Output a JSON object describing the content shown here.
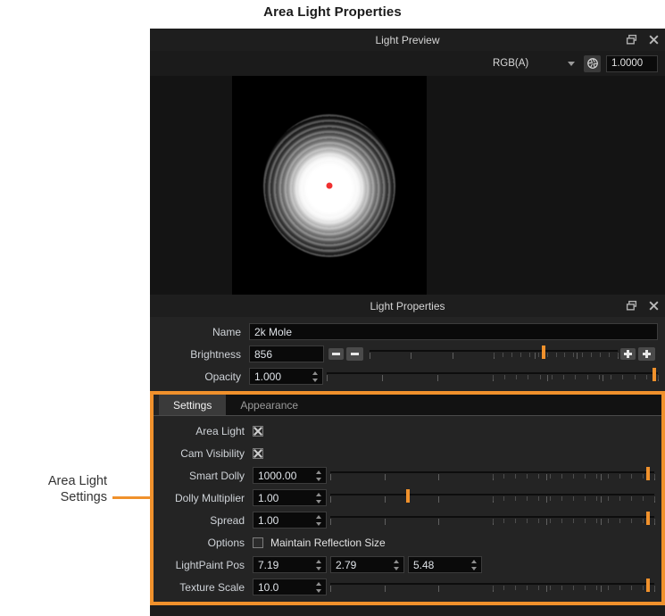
{
  "figure": {
    "title": "Area Light Properties",
    "annotation": "Area Light\nSettings",
    "annotation_line1": "Area Light",
    "annotation_line2": "Settings",
    "accent_color": "#f0912c"
  },
  "preview_panel": {
    "title": "Light Preview",
    "restore_icon": "restore-icon",
    "close_icon": "close-icon",
    "channel_select": {
      "value": "RGB(A)",
      "caret_icon": "chevron-down-icon"
    },
    "aperture_icon": "aperture-icon",
    "exposure_value": "1.0000",
    "viewport": {
      "center_dot_color": "#f03030",
      "background_color": "#000000"
    }
  },
  "properties_panel": {
    "title": "Light Properties",
    "restore_icon": "restore-icon",
    "close_icon": "close-icon",
    "rows": {
      "name": {
        "label": "Name",
        "value": "2k Mole"
      },
      "brightness": {
        "label": "Brightness",
        "value": "856",
        "slider_percent": 70
      },
      "opacity": {
        "label": "Opacity",
        "value": "1.000",
        "slider_percent": 99
      }
    }
  },
  "settings_panel": {
    "tabs": [
      {
        "label": "Settings",
        "active": true
      },
      {
        "label": "Appearance",
        "active": false
      }
    ],
    "rows": {
      "area_light": {
        "label": "Area Light",
        "checked": true
      },
      "cam_visibility": {
        "label": "Cam Visibility",
        "checked": true
      },
      "smart_dolly": {
        "label": "Smart Dolly",
        "value": "1000.00",
        "slider_percent": 98
      },
      "dolly_multiplier": {
        "label": "Dolly Multiplier",
        "value": "1.00",
        "slider_percent": 24
      },
      "spread": {
        "label": "Spread",
        "value": "1.00",
        "slider_percent": 98
      },
      "options": {
        "label": "Options",
        "checkbox_label": "Maintain Reflection Size",
        "checked": false
      },
      "lightpaint_pos": {
        "label": "LightPaint Pos",
        "x": "7.19",
        "y": "2.79",
        "z": "5.48"
      },
      "texture_scale": {
        "label": "Texture Scale",
        "value": "10.0",
        "slider_percent": 98
      }
    }
  }
}
